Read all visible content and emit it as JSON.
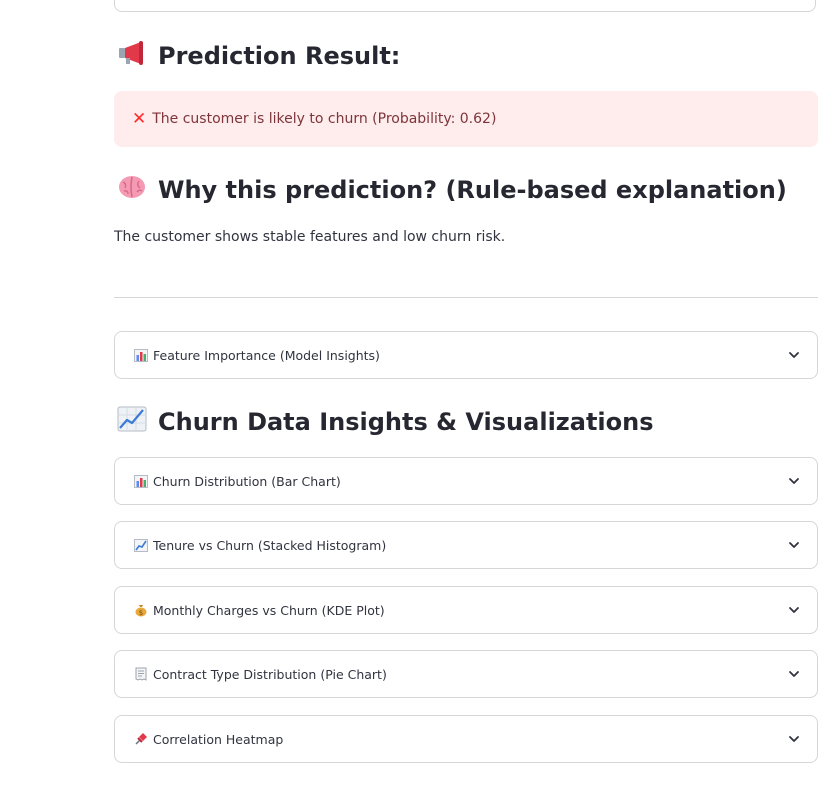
{
  "prediction": {
    "heading": "Prediction Result:",
    "heading_icon": "megaphone-icon",
    "alert_icon": "cross-mark-icon",
    "alert_text": "The customer is likely to churn (Probability: 0.62)"
  },
  "explanation": {
    "heading": "Why this prediction? (Rule-based explanation)",
    "heading_icon": "brain-icon",
    "text": "The customer shows stable features and low churn risk."
  },
  "feature_expander": {
    "icon": "bar-chart-icon",
    "label": "Feature Importance (Model Insights)"
  },
  "insights": {
    "heading": "Churn Data Insights & Visualizations",
    "heading_icon": "chart-increasing-icon",
    "expanders": [
      {
        "icon": "bar-chart-icon",
        "label": "Churn Distribution (Bar Chart)"
      },
      {
        "icon": "chart-increasing-icon",
        "label": "Tenure vs Churn (Stacked Histogram)"
      },
      {
        "icon": "money-bag-icon",
        "label": "Monthly Charges vs Churn (KDE Plot)"
      },
      {
        "icon": "receipt-icon",
        "label": "Contract Type Distribution (Pie Chart)"
      },
      {
        "icon": "pushpin-icon",
        "label": "Correlation Heatmap"
      }
    ]
  },
  "colors": {
    "error_bg": "#ffecec",
    "error_text": "#7d353b",
    "error_icon": "#ff2b2b",
    "border": "#d6d6d9",
    "text": "#31333f"
  }
}
